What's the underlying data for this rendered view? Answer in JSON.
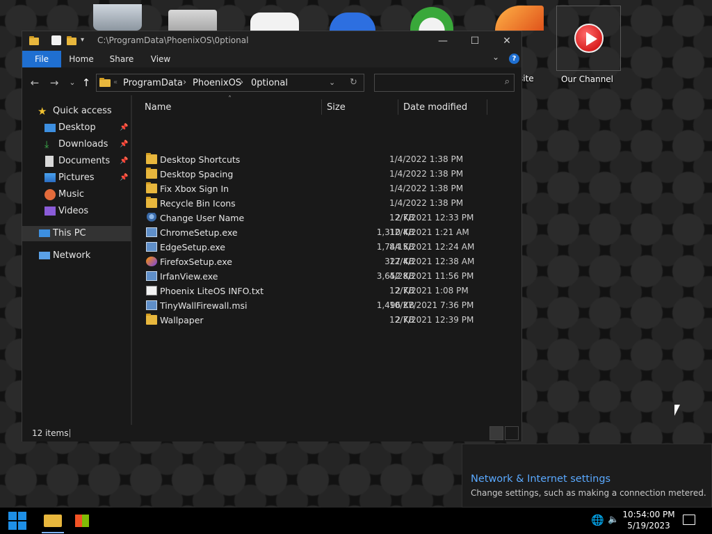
{
  "desktop": {
    "icons": [
      {
        "label": "",
        "icon": "recycle-bin-icon"
      },
      {
        "label": "",
        "icon": "folder-icon"
      },
      {
        "label": "",
        "icon": "xbox-controller-icon"
      },
      {
        "label": "",
        "icon": "app-store-icon"
      },
      {
        "label": "",
        "icon": "xbox-icon"
      },
      {
        "label": "site",
        "icon": "phoenix-icon"
      },
      {
        "label": "Our Channel",
        "icon": "youtube-play-icon"
      }
    ]
  },
  "window": {
    "title_path": "C:\\ProgramData\\PhoenixOS\\0ptional",
    "controls": {
      "minimize": "—",
      "maximize": "☐",
      "close": "✕"
    },
    "ribbon_tabs": [
      "File",
      "Home",
      "Share",
      "View"
    ],
    "breadcrumb": [
      "ProgramData",
      "PhoenixOS",
      "0ptional"
    ],
    "search_placeholder": "",
    "nav": {
      "quick_access": "Quick access",
      "items": [
        {
          "label": "Desktop",
          "pinned": true,
          "icon": "desktop-icon"
        },
        {
          "label": "Downloads",
          "pinned": true,
          "icon": "download-icon"
        },
        {
          "label": "Documents",
          "pinned": true,
          "icon": "document-icon"
        },
        {
          "label": "Pictures",
          "pinned": true,
          "icon": "picture-icon"
        },
        {
          "label": "Music",
          "pinned": false,
          "icon": "music-icon"
        },
        {
          "label": "Videos",
          "pinned": false,
          "icon": "video-icon"
        }
      ],
      "this_pc": "This PC",
      "network": "Network"
    },
    "columns": {
      "name": "Name",
      "size": "Size",
      "date": "Date modified"
    },
    "files": [
      {
        "name": "Desktop Shortcuts",
        "size": "",
        "date": "1/4/2022 1:38 PM",
        "type": "folder"
      },
      {
        "name": "Desktop Spacing",
        "size": "",
        "date": "1/4/2022 1:38 PM",
        "type": "folder"
      },
      {
        "name": "Fix Xbox Sign In",
        "size": "",
        "date": "1/4/2022 1:38 PM",
        "type": "folder"
      },
      {
        "name": "Recycle Bin Icons",
        "size": "",
        "date": "1/4/2022 1:38 PM",
        "type": "folder"
      },
      {
        "name": "Change User Name",
        "size": "2 KB",
        "date": "12/7/2021 12:33 PM",
        "type": "user"
      },
      {
        "name": "ChromeSetup.exe",
        "size": "1,310 KB",
        "date": "12/4/2021 1:21 AM",
        "type": "exe"
      },
      {
        "name": "EdgeSetup.exe",
        "size": "1,744 KB",
        "date": "8/15/2021 12:24 AM",
        "type": "exe"
      },
      {
        "name": "FirefoxSetup.exe",
        "size": "327 KB",
        "date": "12/4/2021 12:38 AM",
        "type": "firefox"
      },
      {
        "name": "IrfanView.exe",
        "size": "3,652 KB",
        "date": "4/28/2021 11:56 PM",
        "type": "exe"
      },
      {
        "name": "Phoenix LiteOS INFO.txt",
        "size": "2 KB",
        "date": "12/7/2021 1:08 PM",
        "type": "txt"
      },
      {
        "name": "TinyWallFirewall.msi",
        "size": "1,496 KB",
        "date": "10/27/2021 7:36 PM",
        "type": "exe"
      },
      {
        "name": "Wallpaper",
        "size": "2 KB",
        "date": "12/7/2021 12:39 PM",
        "type": "folder"
      }
    ],
    "status": "12 items"
  },
  "toast": {
    "title": "Network & Internet settings",
    "subtitle": "Change settings, such as making a connection metered."
  },
  "taskbar": {
    "time": "10:54:00 PM",
    "date": "5/19/2023"
  },
  "colors": {
    "accent": "#1f6fd1",
    "link": "#5aa9ff"
  }
}
